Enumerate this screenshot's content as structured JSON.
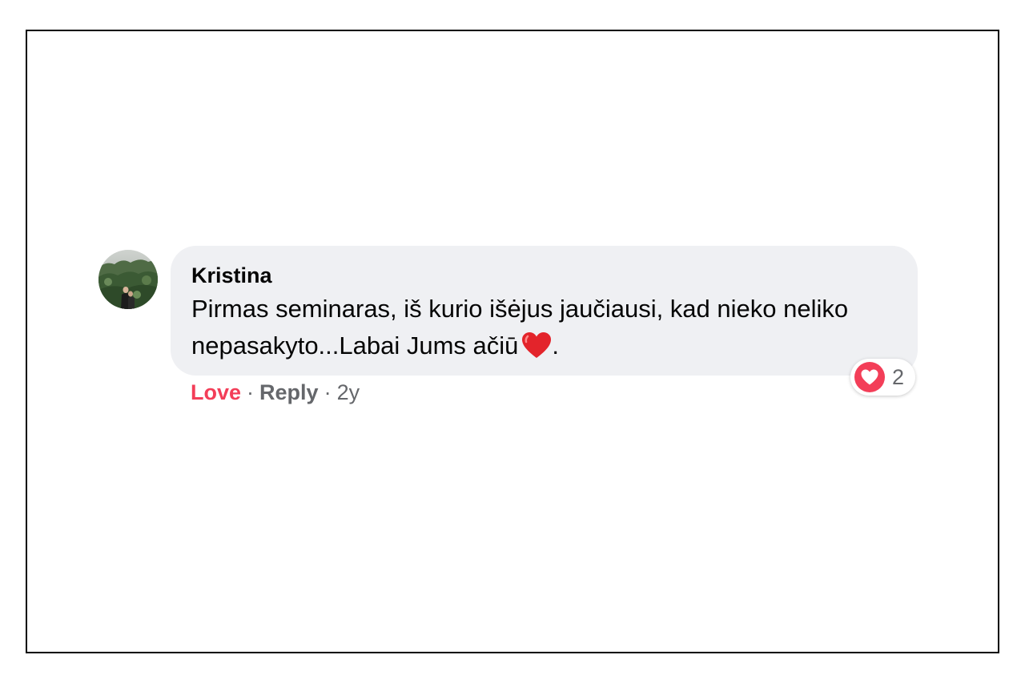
{
  "comment": {
    "author": "Kristina",
    "text": "Pirmas seminaras, iš kurio išėjus jaučiausi, kad nieko neliko nepasakyto...Labai Jums ačiū",
    "text_suffix": ".",
    "inline_emoji": "red-heart-emoji"
  },
  "reactions": {
    "icon": "love-reaction-icon",
    "count": "2"
  },
  "actions": {
    "love_label": "Love",
    "reply_label": "Reply",
    "separator": "·",
    "timestamp": "2y"
  },
  "colors": {
    "bubble": "#eff0f3",
    "love": "#f33e58",
    "secondary_text": "#65676b"
  }
}
